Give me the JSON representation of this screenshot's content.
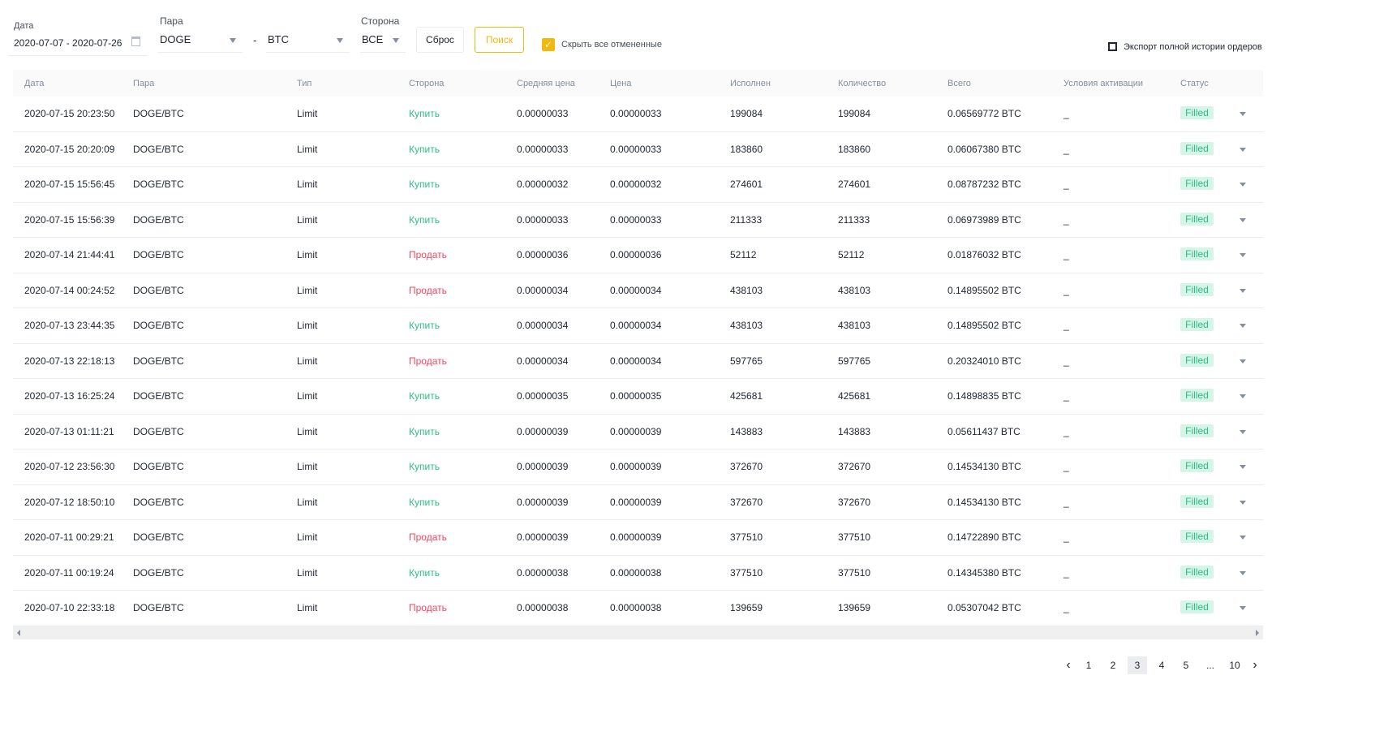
{
  "filters": {
    "date_label": "Дата",
    "date_value": "2020-07-07 - 2020-07-26",
    "pair_label": "Пара",
    "base": "DOGE",
    "separator": "-",
    "quote": "BTC",
    "side_label": "Сторона",
    "side_value": "ВСЕ",
    "reset": "Сброс",
    "search": "Поиск",
    "hide_cancelled": "Скрыть все отмененные",
    "hide_cancelled_checked": true,
    "export": "Экспорт полной истории ордеров"
  },
  "colors": {
    "accent": "#f0b90b",
    "buy": "#2ebd85",
    "sell": "#f6465d"
  },
  "columns": [
    "Дата",
    "Пара",
    "Тип",
    "Сторона",
    "Средняя цена",
    "Цена",
    "Исполнен",
    "Количество",
    "Всего",
    "Условия активации",
    "Статус"
  ],
  "rows": [
    [
      "2020-07-15 20:23:50",
      "DOGE/BTC",
      "Limit",
      "Купить",
      "0.00000033",
      "0.00000033",
      "199084",
      "199084",
      "0.06569772 BTC",
      "_",
      "Filled"
    ],
    [
      "2020-07-15 20:20:09",
      "DOGE/BTC",
      "Limit",
      "Купить",
      "0.00000033",
      "0.00000033",
      "183860",
      "183860",
      "0.06067380 BTC",
      "_",
      "Filled"
    ],
    [
      "2020-07-15 15:56:45",
      "DOGE/BTC",
      "Limit",
      "Купить",
      "0.00000032",
      "0.00000032",
      "274601",
      "274601",
      "0.08787232 BTC",
      "_",
      "Filled"
    ],
    [
      "2020-07-15 15:56:39",
      "DOGE/BTC",
      "Limit",
      "Купить",
      "0.00000033",
      "0.00000033",
      "211333",
      "211333",
      "0.06973989 BTC",
      "_",
      "Filled"
    ],
    [
      "2020-07-14 21:44:41",
      "DOGE/BTC",
      "Limit",
      "Продать",
      "0.00000036",
      "0.00000036",
      "52112",
      "52112",
      "0.01876032 BTC",
      "_",
      "Filled"
    ],
    [
      "2020-07-14 00:24:52",
      "DOGE/BTC",
      "Limit",
      "Продать",
      "0.00000034",
      "0.00000034",
      "438103",
      "438103",
      "0.14895502 BTC",
      "_",
      "Filled"
    ],
    [
      "2020-07-13 23:44:35",
      "DOGE/BTC",
      "Limit",
      "Купить",
      "0.00000034",
      "0.00000034",
      "438103",
      "438103",
      "0.14895502 BTC",
      "_",
      "Filled"
    ],
    [
      "2020-07-13 22:18:13",
      "DOGE/BTC",
      "Limit",
      "Продать",
      "0.00000034",
      "0.00000034",
      "597765",
      "597765",
      "0.20324010 BTC",
      "_",
      "Filled"
    ],
    [
      "2020-07-13 16:25:24",
      "DOGE/BTC",
      "Limit",
      "Купить",
      "0.00000035",
      "0.00000035",
      "425681",
      "425681",
      "0.14898835 BTC",
      "_",
      "Filled"
    ],
    [
      "2020-07-13 01:11:21",
      "DOGE/BTC",
      "Limit",
      "Купить",
      "0.00000039",
      "0.00000039",
      "143883",
      "143883",
      "0.05611437 BTC",
      "_",
      "Filled"
    ],
    [
      "2020-07-12 23:56:30",
      "DOGE/BTC",
      "Limit",
      "Купить",
      "0.00000039",
      "0.00000039",
      "372670",
      "372670",
      "0.14534130 BTC",
      "_",
      "Filled"
    ],
    [
      "2020-07-12 18:50:10",
      "DOGE/BTC",
      "Limit",
      "Купить",
      "0.00000039",
      "0.00000039",
      "372670",
      "372670",
      "0.14534130 BTC",
      "_",
      "Filled"
    ],
    [
      "2020-07-11 00:29:21",
      "DOGE/BTC",
      "Limit",
      "Продать",
      "0.00000039",
      "0.00000039",
      "377510",
      "377510",
      "0.14722890 BTC",
      "_",
      "Filled"
    ],
    [
      "2020-07-11 00:19:24",
      "DOGE/BTC",
      "Limit",
      "Купить",
      "0.00000038",
      "0.00000038",
      "377510",
      "377510",
      "0.14345380 BTC",
      "_",
      "Filled"
    ],
    [
      "2020-07-10 22:33:18",
      "DOGE/BTC",
      "Limit",
      "Продать",
      "0.00000038",
      "0.00000038",
      "139659",
      "139659",
      "0.05307042 BTC",
      "_",
      "Filled"
    ]
  ],
  "pagination": {
    "pages": [
      "1",
      "2",
      "3",
      "4",
      "5",
      "...",
      "10"
    ],
    "current": "3"
  }
}
